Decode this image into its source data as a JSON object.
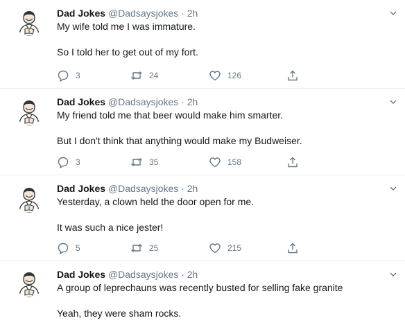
{
  "tweets": [
    {
      "name": "Dad Jokes",
      "handle": "@Dadsaysjokes",
      "separator": "·",
      "time": "2h",
      "line1": "My wife told me I was immature.",
      "line2": "So I told her to get out of my fort.",
      "replies": "3",
      "retweets": "24",
      "likes": "126"
    },
    {
      "name": "Dad Jokes",
      "handle": "@Dadsaysjokes",
      "separator": "·",
      "time": "2h",
      "line1": "My friend told me that beer would make him smarter.",
      "line2": "But I don't think that anything would make my Budweiser.",
      "replies": "3",
      "retweets": "35",
      "likes": "158"
    },
    {
      "name": "Dad Jokes",
      "handle": "@Dadsaysjokes",
      "separator": "·",
      "time": "2h",
      "line1": "Yesterday, a clown held the door open for me.",
      "line2": "It was such a nice jester!",
      "replies": "5",
      "retweets": "25",
      "likes": "215"
    },
    {
      "name": "Dad Jokes",
      "handle": "@Dadsaysjokes",
      "separator": "·",
      "time": "2h",
      "line1": "A group of leprechauns was recently busted for selling fake granite",
      "line2": "Yeah, they were sham rocks."
    }
  ],
  "icons": {
    "avatar": "dad-cartoon-avatar-icon",
    "caret": "chevron-down-icon",
    "reply": "reply-bubble-icon",
    "retweet": "retweet-icon",
    "like": "heart-icon",
    "share": "share-icon"
  },
  "colors": {
    "text": "#14171a",
    "muted": "#657786",
    "divider": "#e6ecf0"
  }
}
